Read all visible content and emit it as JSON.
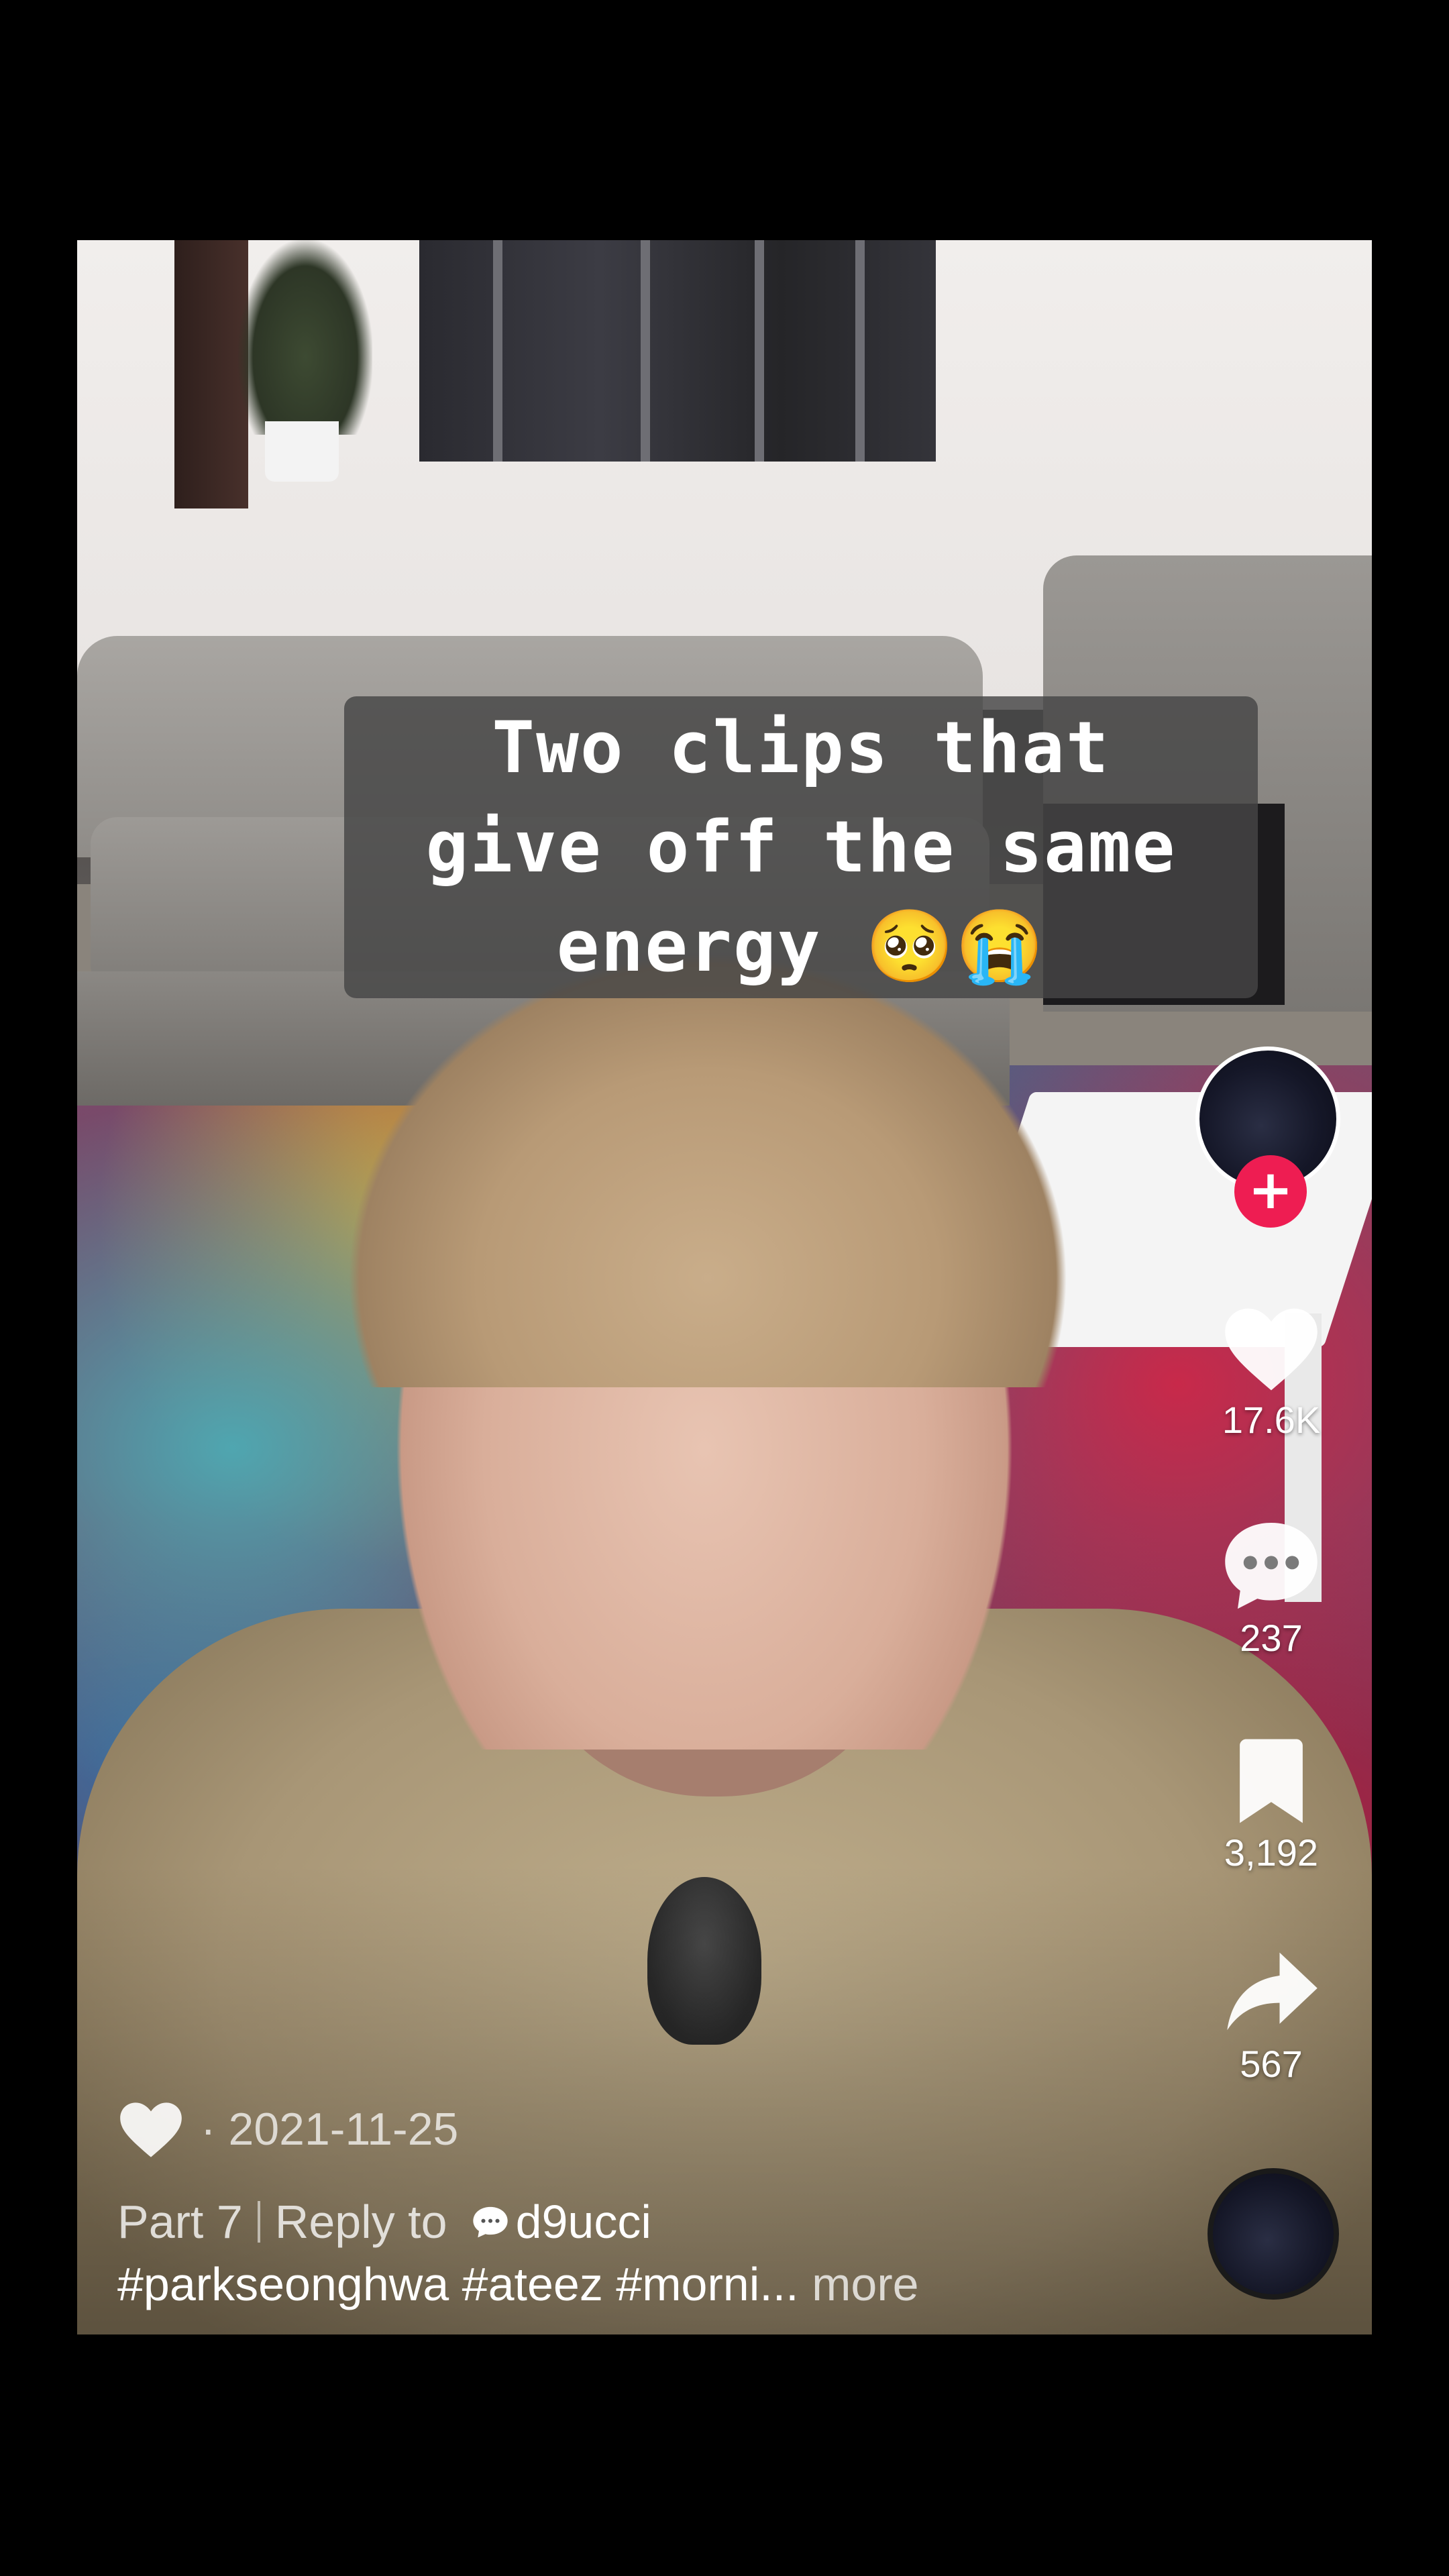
{
  "caption": {
    "line1": "Two clips that",
    "line2": "give off the same",
    "line3": "energy 🥺😭"
  },
  "rail": {
    "follow_symbol": "+",
    "like_count": "17.6K",
    "comment_count": "237",
    "bookmark_count": "3,192",
    "share_count": "567"
  },
  "meta": {
    "date": "· 2021-11-25"
  },
  "description": {
    "part_label": "Part 7",
    "reply_label": "Reply to",
    "reply_user": "d9ucci",
    "hashtags": "#parkseonghwa #ateez #morni...",
    "more_label": "more"
  },
  "colors": {
    "follow_accent": "#ee1d52",
    "background": "#000000"
  },
  "icons": {
    "like": "heart-icon",
    "comment": "comment-bubble-icon",
    "bookmark": "bookmark-icon",
    "share": "share-arrow-icon",
    "meta_like": "heart-outline-icon",
    "reply": "chat-bubble-icon"
  }
}
